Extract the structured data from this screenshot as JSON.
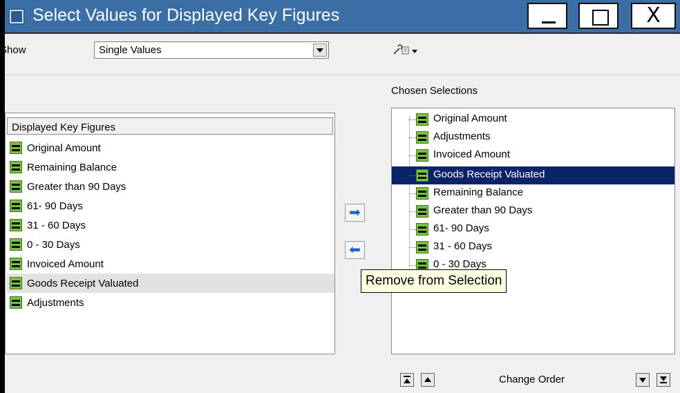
{
  "window": {
    "title": "Select Values for Displayed Key Figures",
    "minimize": "_",
    "maximize": "□",
    "close": "X"
  },
  "toolbar": {
    "show_label": "Show",
    "show_value": "Single Values",
    "settings_glyph": "⚙"
  },
  "left_panel": {
    "header": "Displayed Key Figures",
    "items": [
      {
        "label": "Original Amount"
      },
      {
        "label": "Remaining Balance"
      },
      {
        "label": "Greater than 90 Days"
      },
      {
        "label": "61- 90 Days"
      },
      {
        "label": "31 - 60 Days"
      },
      {
        "label": "0 - 30 Days"
      },
      {
        "label": "Invoiced Amount"
      },
      {
        "label": "Goods Receipt Valuated",
        "selected": true
      },
      {
        "label": "Adjustments"
      }
    ]
  },
  "transfer": {
    "add_glyph": "➡",
    "remove_glyph": "⬅",
    "tooltip": "Remove from Selection"
  },
  "right_panel": {
    "header": "Chosen Selections",
    "items": [
      {
        "label": "Original Amount"
      },
      {
        "label": "Adjustments"
      },
      {
        "label": "Invoiced Amount"
      },
      {
        "label": "Goods Receipt Valuated",
        "selected": true
      },
      {
        "label": "Remaining Balance"
      },
      {
        "label": "Greater than 90 Days"
      },
      {
        "label": "61- 90 Days"
      },
      {
        "label": "31 - 60 Days"
      },
      {
        "label": "0 - 30 Days"
      }
    ],
    "change_order": "Change Order"
  },
  "colors": {
    "titlebar": "#3a6ea5",
    "selection": "#0a246a",
    "key_figure_icon": "#7ac143",
    "tooltip_bg": "#ffffe1"
  }
}
